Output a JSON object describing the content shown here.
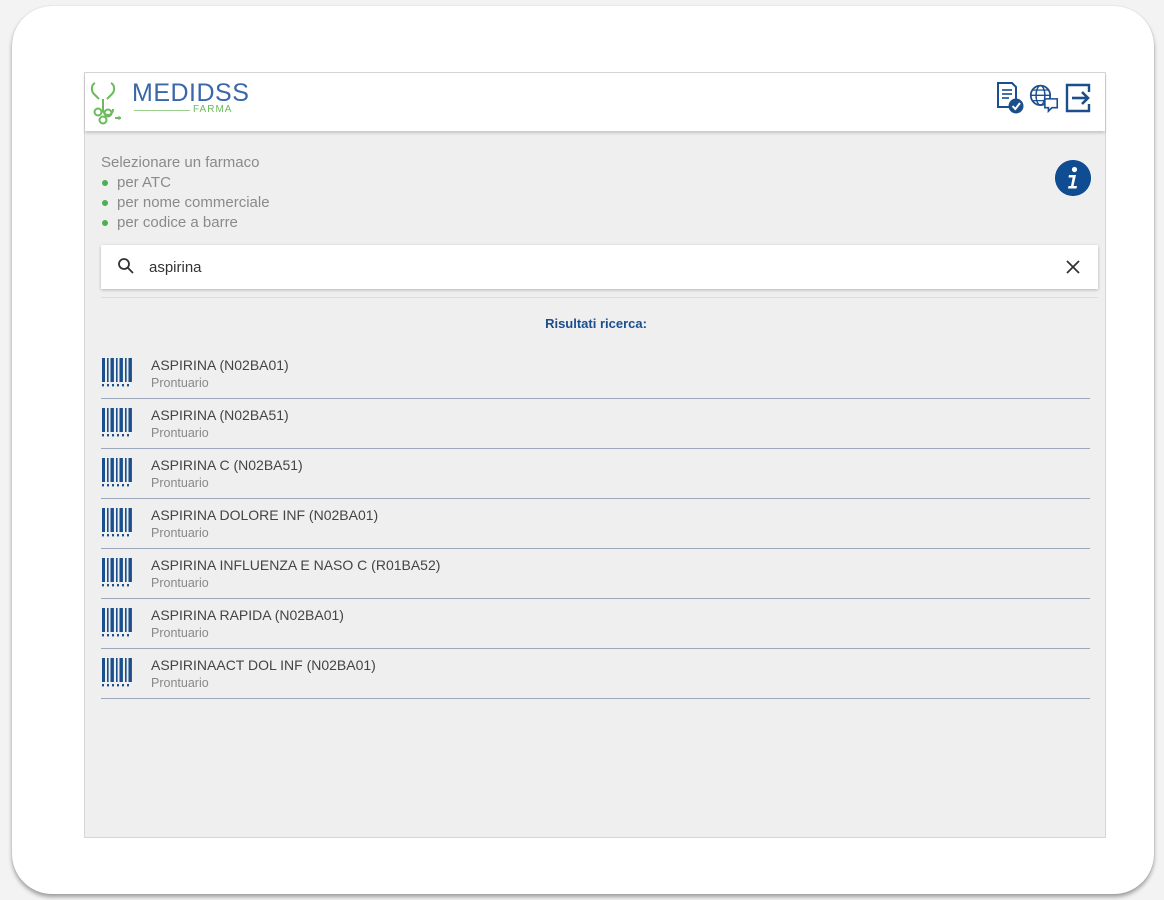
{
  "header": {
    "brand": "MEDIDSS",
    "brand_sub": "FARMA",
    "icons": [
      "document-check-icon",
      "globe-chat-icon",
      "logout-icon"
    ]
  },
  "instructions": {
    "title": "Selezionare un farmaco",
    "items": [
      "per ATC",
      "per nome commerciale",
      "per codice a barre"
    ]
  },
  "info_icon": "info-icon",
  "search": {
    "value": "aspirina",
    "placeholder": ""
  },
  "results": {
    "title": "Risultati ricerca:",
    "items": [
      {
        "name": "ASPIRINA (N02BA01)",
        "source": "Prontuario"
      },
      {
        "name": "ASPIRINA (N02BA51)",
        "source": "Prontuario"
      },
      {
        "name": "ASPIRINA C (N02BA51)",
        "source": "Prontuario"
      },
      {
        "name": "ASPIRINA DOLORE INF (N02BA01)",
        "source": "Prontuario"
      },
      {
        "name": "ASPIRINA INFLUENZA E NASO C (R01BA52)",
        "source": "Prontuario"
      },
      {
        "name": "ASPIRINA RAPIDA (N02BA01)",
        "source": "Prontuario"
      },
      {
        "name": "ASPIRINAACT DOL INF (N02BA01)",
        "source": "Prontuario"
      }
    ]
  },
  "colors": {
    "primary": "#0f4c91",
    "brand_blue": "#3a67a8",
    "brand_green": "#6cba5d",
    "bullet": "#4caf50",
    "background": "#efefef"
  }
}
